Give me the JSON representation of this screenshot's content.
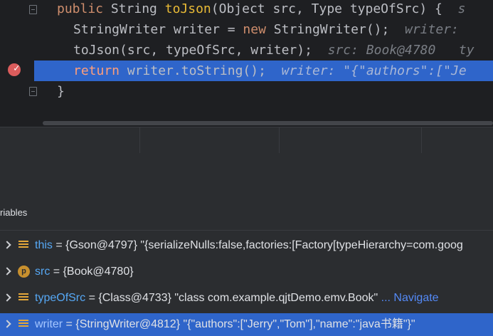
{
  "editor": {
    "lines": [
      {
        "kw1": "public",
        "sp": " String ",
        "fn": "toJson",
        "rest": "(Object src, Type typeOfSrc) {",
        "hint": "  s"
      },
      {
        "pre": "StringWriter writer = ",
        "kw": "new",
        "rest": " StringWriter();",
        "hint": "  writer: "
      },
      {
        "code": "toJson(src, typeOfSrc, writer);",
        "hint": "  src: Book@4780   ty"
      },
      {
        "kw": "return",
        "rest": " writer.toString();",
        "hint": "  writer: \"{\"authors\":[\"Je"
      },
      {
        "code": "}"
      }
    ]
  },
  "debugger": {
    "section_title": "riables",
    "variables": [
      {
        "name": "this",
        "value": " = {Gson@4797} \"{serializeNulls:false,factories:[Factory[typeHierarchy=com.goog",
        "icon": "field-icon"
      },
      {
        "name": "src",
        "value": " = {Book@4780}",
        "icon": "parameter-icon",
        "icon_letter": "p"
      },
      {
        "name": "typeOfSrc",
        "value": " = {Class@4733} \"class com.example.qjtDemo.emv.Book\"",
        "link": " ... Navigate",
        "icon": "field-icon"
      },
      {
        "name": "writer",
        "value": " = {StringWriter@4812} \"{\"authors\":[\"Jerry\",\"Tom\"],\"name\":\"java书籍\"}\"",
        "icon": "field-icon"
      }
    ]
  },
  "colors": {
    "selection": "#2f65ca",
    "breakpoint": "#db5c5c",
    "keyword": "#cf8e6d",
    "var_name": "#56a8f5"
  }
}
